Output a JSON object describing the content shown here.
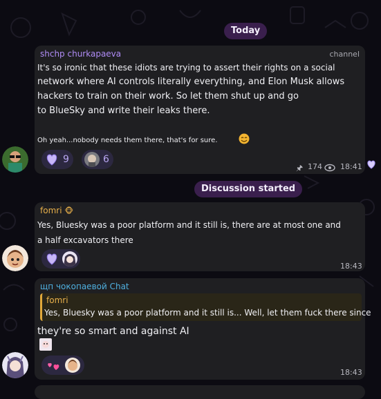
{
  "date_pill": "Today",
  "discussion_pill": "Discussion started",
  "channel_post": {
    "sender": "shchp churkapaeva",
    "tag": "channel",
    "lines": [
      "It's so ironic that these idiots are trying to assert their rights on a social",
      "network where AI controls literally everything, and Elon Musk allows",
      "hackers to train on their work. So let them shut up and go",
      "to BlueSky and write their leaks there."
    ],
    "footer": "Oh yeah...nobody needs them there, that's for sure.",
    "reactions": [
      {
        "icon": "purple-heart-icon",
        "count": "9"
      },
      {
        "icon": "face-avatar-icon",
        "count": "6"
      }
    ],
    "views": "174",
    "time": "18:41"
  },
  "comment1": {
    "sender": "fomri",
    "lines": [
      "Yes, Bluesky was a poor platform and it still is, there are at most one and",
      "a half excavators there"
    ],
    "time": "18:43"
  },
  "comment2": {
    "sender": "щп чокопаевой Chat",
    "quote_sender": "fomri",
    "quote_text": "Yes, Bluesky was a poor platform and it still is... Well, let them fuck there since",
    "text": "they're so smart and against AI",
    "time": "18:43"
  },
  "colors": {
    "pill": "#3a1f4d",
    "bubble": "#1f1f22",
    "channel_name": "#b08cf6",
    "fomri_name": "#e8b04a",
    "chat_name": "#4fb0e0",
    "quote_bar": "#e0a83a"
  }
}
